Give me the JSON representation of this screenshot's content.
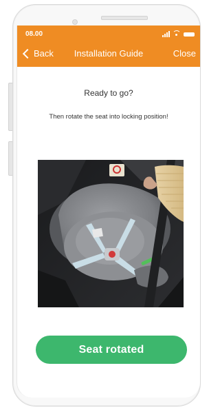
{
  "status_bar": {
    "time": "08.00",
    "icons": [
      "signal-icon",
      "wifi-icon",
      "battery-icon"
    ]
  },
  "nav": {
    "back_label": "Back",
    "title": "Installation Guide",
    "close_label": "Close"
  },
  "content": {
    "heading": "Ready to go?",
    "instruction": "Then rotate the seat into locking position!",
    "image_description": "photo-baby-car-seat-rotation"
  },
  "cta": {
    "label": "Seat rotated"
  },
  "colors": {
    "header": "#ef8c23",
    "button": "#3db76d",
    "text": "#333333"
  }
}
